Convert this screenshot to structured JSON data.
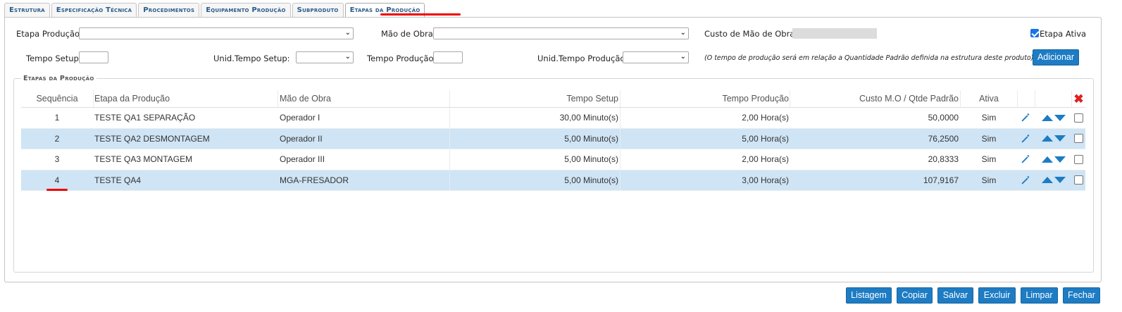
{
  "tabs": [
    {
      "label": "Estrutura"
    },
    {
      "label": "Especificação Técnica"
    },
    {
      "label": "Procedimentos"
    },
    {
      "label": "Equipamento Produção"
    },
    {
      "label": "Subproduto"
    },
    {
      "label": "Etapas da Produção",
      "active": true
    }
  ],
  "form": {
    "etapa_producao_label": "Etapa Produção:",
    "etapa_producao_value": "",
    "mao_de_obra_label": "Mão de Obra:",
    "mao_de_obra_value": "",
    "custo_label": "Custo de Mão de Obra:",
    "custo_value": "",
    "etapa_ativa_label": "Etapa Ativa",
    "etapa_ativa_checked": true,
    "tempo_setup_label": "Tempo Setup:",
    "tempo_setup_value": "",
    "unid_tempo_setup_label": "Unid.Tempo Setup:",
    "unid_tempo_setup_value": "",
    "tempo_producao_label": "Tempo Produção:",
    "tempo_producao_value": "",
    "unid_tempo_producao_label": "Unid.Tempo Produção:",
    "unid_tempo_producao_value": "",
    "note": "(O tempo de produção será em relação a Quantidade Padrão definida na estrutura deste produto)",
    "adicionar_label": "Adicionar"
  },
  "section": {
    "legend": "Etapas da Produção"
  },
  "table": {
    "columns": {
      "seq": "Sequência",
      "etapa": "Etapa da Produção",
      "mao": "Mão de Obra",
      "setup": "Tempo Setup",
      "prod": "Tempo Produção",
      "custo": "Custo M.O / Qtde Padrão",
      "ativa": "Ativa"
    },
    "rows": [
      {
        "seq": "1",
        "etapa": "TESTE QA1 SEPARAÇÃO",
        "mao": "Operador I",
        "setup": "30,00 Minuto(s)",
        "prod": "2,00 Hora(s)",
        "custo": "50,0000",
        "ativa": "Sim"
      },
      {
        "seq": "2",
        "etapa": "TESTE QA2 DESMONTAGEM",
        "mao": "Operador II",
        "setup": "5,00 Minuto(s)",
        "prod": "5,00 Hora(s)",
        "custo": "76,2500",
        "ativa": "Sim"
      },
      {
        "seq": "3",
        "etapa": "TESTE QA3 MONTAGEM",
        "mao": "Operador III",
        "setup": "5,00 Minuto(s)",
        "prod": "2,00 Hora(s)",
        "custo": "20,8333",
        "ativa": "Sim"
      },
      {
        "seq": "4",
        "etapa": "TESTE QA4",
        "mao": "MGA-FRESADOR",
        "setup": "5,00 Minuto(s)",
        "prod": "3,00 Hora(s)",
        "custo": "107,9167",
        "ativa": "Sim"
      }
    ]
  },
  "footer_buttons": {
    "listagem": "Listagem",
    "copiar": "Copiar",
    "salvar": "Salvar",
    "excluir": "Excluir",
    "limpar": "Limpar",
    "fechar": "Fechar"
  },
  "colors": {
    "accent": "#1d7cc4",
    "row_highlight": "#cfe4f4",
    "annotation_red": "#e00000"
  }
}
